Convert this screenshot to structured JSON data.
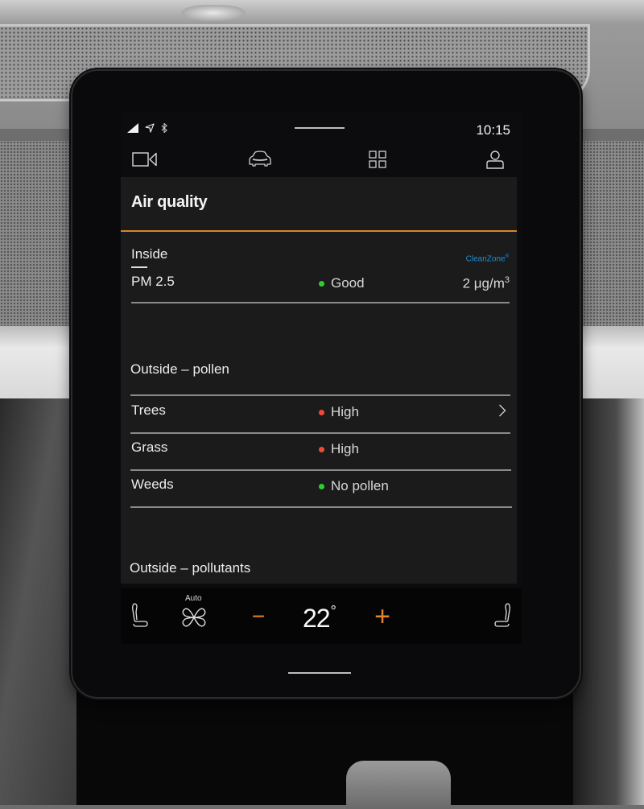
{
  "status_bar": {
    "time": "10:15",
    "icons": [
      "signal-icon",
      "navigation-icon",
      "bluetooth-icon"
    ]
  },
  "nav": {
    "items": [
      {
        "name": "camera",
        "icon": "camera-icon"
      },
      {
        "name": "car",
        "icon": "car-icon"
      },
      {
        "name": "apps",
        "icon": "app-grid-icon"
      },
      {
        "name": "profile",
        "icon": "profile-icon"
      }
    ]
  },
  "panel": {
    "title": "Air quality",
    "accent_color": "#d9822b",
    "inside": {
      "label": "Inside",
      "brand": "CleanZone",
      "brand_mark": "®",
      "brand_color": "#1e8fd0",
      "rows": [
        {
          "name": "PM 2.5",
          "status": "Good",
          "status_color": "#2ecc2e",
          "value": "2 μg/m",
          "value_sup": "3"
        }
      ]
    },
    "pollen": {
      "label": "Outside – pollen",
      "rows": [
        {
          "name": "Trees",
          "status": "High",
          "status_color": "#f04a36",
          "has_chevron": true
        },
        {
          "name": "Grass",
          "status": "High",
          "status_color": "#f04a36",
          "has_chevron": false
        },
        {
          "name": "Weeds",
          "status": "No pollen",
          "status_color": "#2ecc2e",
          "has_chevron": false
        }
      ]
    },
    "pollutants": {
      "label": "Outside – pollutants"
    }
  },
  "climate": {
    "fan_mode": "Auto",
    "temperature": "22",
    "temperature_unit": "°",
    "decrease_symbol": "−",
    "increase_symbol": "+",
    "control_color": "#e0862c"
  }
}
